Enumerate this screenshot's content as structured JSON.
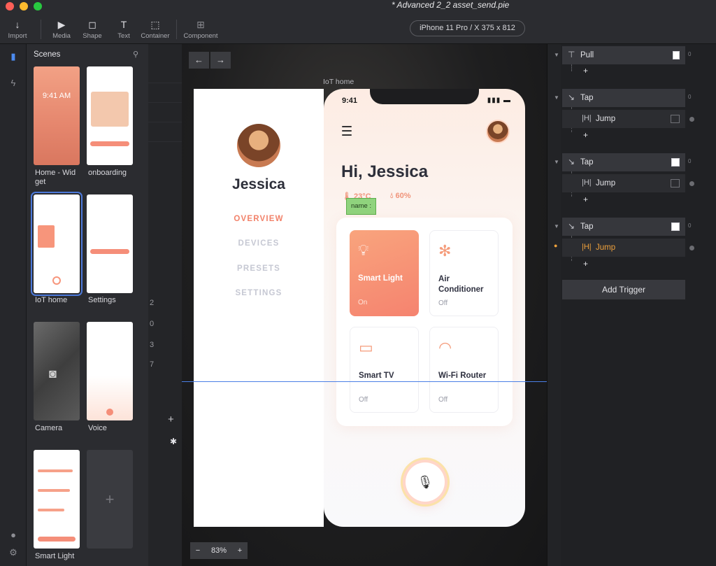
{
  "app": {
    "document_title": "* Advanced 2_2 asset_send.pie",
    "device_selector": "iPhone 11 Pro / X  375 x 812"
  },
  "toolbar": {
    "import": "Import",
    "media": "Media",
    "shape": "Shape",
    "text": "Text",
    "container": "Container",
    "component": "Component"
  },
  "scenes_panel": {
    "title": "Scenes",
    "scenes": [
      {
        "label": "Home - Wid get"
      },
      {
        "label": "onboarding"
      },
      {
        "label": "IoT home",
        "selected": true
      },
      {
        "label": "Settings"
      },
      {
        "label": "Camera"
      },
      {
        "label": "Voice"
      },
      {
        "label": "Smart Light"
      }
    ],
    "add_scene": "+"
  },
  "layer_list_peek": {
    "numbers": [
      "2",
      "0",
      "3",
      "7"
    ],
    "add": "+"
  },
  "canvas": {
    "nav_back": "←",
    "nav_forward": "→",
    "scene_name": "IoT home",
    "zoom": {
      "minus": "−",
      "value": "83%",
      "plus": "+"
    }
  },
  "drawer": {
    "user_name": "Jessica",
    "nav": [
      "OVERVIEW",
      "DEVICES",
      "PRESETS",
      "SETTINGS"
    ]
  },
  "phone": {
    "time": "9:41",
    "greeting": "Hi, Jessica",
    "temperature": "23°C",
    "humidity": "60%",
    "name_tag": "name :",
    "devices": [
      {
        "name": "Smart Light",
        "state": "On",
        "icon": "bulb-icon",
        "active": true
      },
      {
        "name": "Air Conditioner",
        "state": "Off",
        "icon": "snowflake-icon",
        "active": false
      },
      {
        "name": "Smart TV",
        "state": "Off",
        "icon": "tv-icon",
        "active": false
      },
      {
        "name": "Wi-Fi Router",
        "state": "Off",
        "icon": "wifi-icon",
        "active": false
      }
    ],
    "accent_color": "#f5836f"
  },
  "interactions": {
    "triggers": [
      {
        "name": "Pull",
        "actions": []
      },
      {
        "name": "Tap",
        "actions": [
          {
            "name": "Jump"
          }
        ]
      },
      {
        "name": "Tap",
        "actions": [
          {
            "name": "Jump"
          }
        ]
      },
      {
        "name": "Tap",
        "actions": [
          {
            "name": "Jump",
            "highlight": true
          }
        ]
      }
    ],
    "add_symbol": "+",
    "add_trigger": "Add Trigger",
    "timeline_tick": "0"
  }
}
